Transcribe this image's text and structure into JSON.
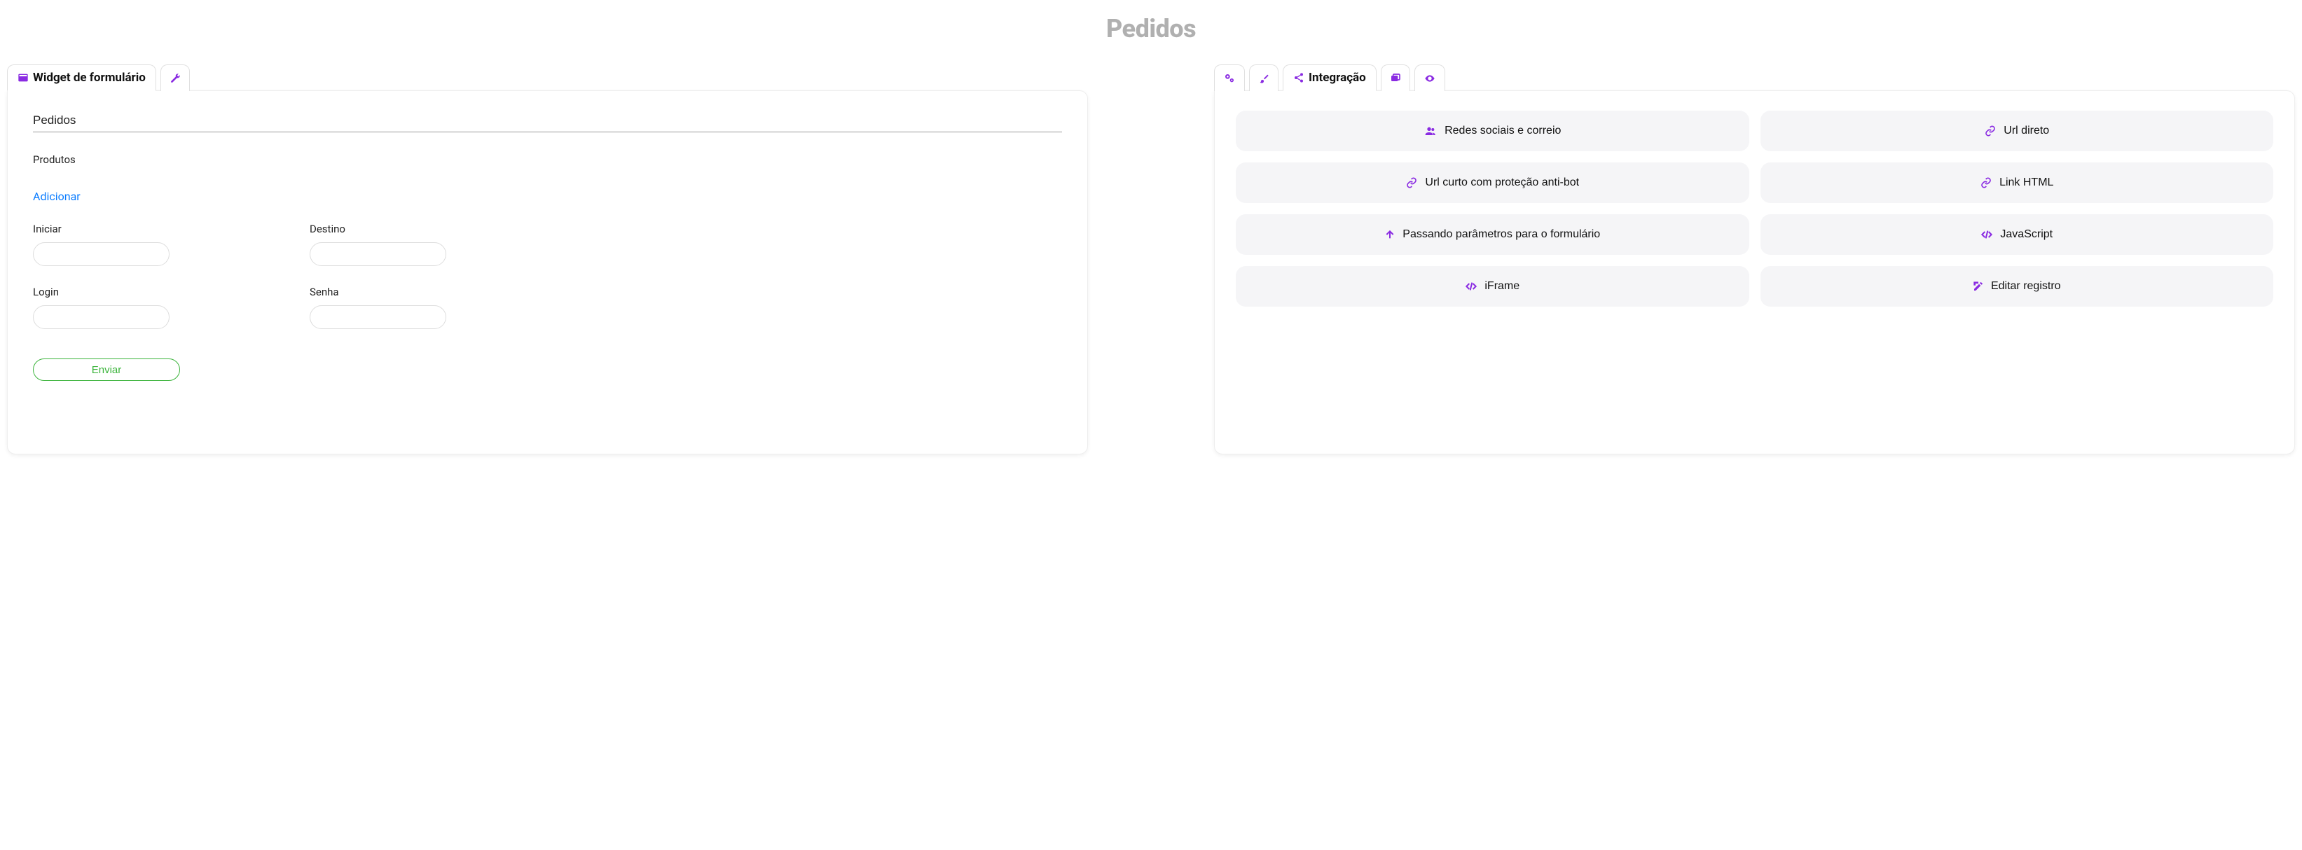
{
  "page": {
    "title": "Pedidos"
  },
  "left": {
    "tabs": {
      "form_widget": "Widget de formulário"
    },
    "form": {
      "title_value": "Pedidos",
      "products_label": "Produtos",
      "add_link": "Adicionar",
      "start_label": "Iniciar",
      "destination_label": "Destino",
      "login_label": "Login",
      "password_label": "Senha",
      "submit_label": "Enviar"
    }
  },
  "right": {
    "tabs": {
      "integration": "Integração"
    },
    "options": {
      "social_mail": "Redes sociais e correio",
      "direct_url": "Url direto",
      "short_url": "Url curto com proteção anti-bot",
      "html_link": "Link HTML",
      "pass_params": "Passando parâmetros para o formulário",
      "javascript": "JavaScript",
      "iframe": "iFrame",
      "edit_record": "Editar registro"
    }
  }
}
